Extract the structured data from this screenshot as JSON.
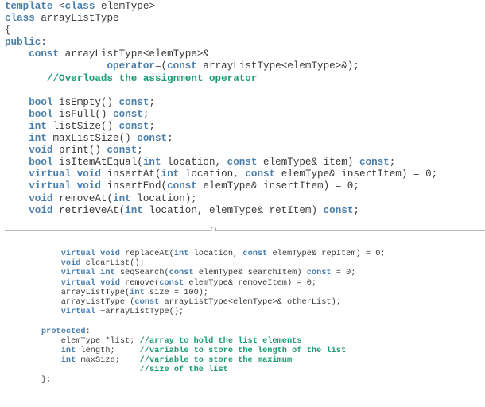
{
  "colors": {
    "keyword": "#4a7fac",
    "comment": "#1e9b76",
    "text": "#3a3a3a",
    "separator": "#b8b8b8"
  },
  "top_section": {
    "lines": [
      [
        {
          "t": "kw",
          "v": "template"
        },
        {
          "t": "tx",
          "v": " <"
        },
        {
          "t": "kw",
          "v": "class"
        },
        {
          "t": "tx",
          "v": " elemType>"
        }
      ],
      [
        {
          "t": "kw",
          "v": "class"
        },
        {
          "t": "tx",
          "v": " arrayListType"
        }
      ],
      [
        {
          "t": "tx",
          "v": "{"
        }
      ],
      [
        {
          "t": "kw",
          "v": "public"
        },
        {
          "t": "tx",
          "v": ":"
        }
      ],
      [
        {
          "t": "tx",
          "v": "    "
        },
        {
          "t": "kw",
          "v": "const"
        },
        {
          "t": "tx",
          "v": " arrayListType<elemType>&"
        }
      ],
      [
        {
          "t": "tx",
          "v": "                 "
        },
        {
          "t": "kw",
          "v": "operator"
        },
        {
          "t": "tx",
          "v": "=("
        },
        {
          "t": "kw",
          "v": "const"
        },
        {
          "t": "tx",
          "v": " arrayListType<elemType>&);"
        }
      ],
      [
        {
          "t": "tx",
          "v": "       "
        },
        {
          "t": "cm",
          "v": "//Overloads the assignment operator"
        }
      ],
      [
        {
          "t": "tx",
          "v": ""
        }
      ],
      [
        {
          "t": "tx",
          "v": "    "
        },
        {
          "t": "kw",
          "v": "bool"
        },
        {
          "t": "tx",
          "v": " isEmpty() "
        },
        {
          "t": "kw",
          "v": "const"
        },
        {
          "t": "tx",
          "v": ";"
        }
      ],
      [
        {
          "t": "tx",
          "v": "    "
        },
        {
          "t": "kw",
          "v": "bool"
        },
        {
          "t": "tx",
          "v": " isFull() "
        },
        {
          "t": "kw",
          "v": "const"
        },
        {
          "t": "tx",
          "v": ";"
        }
      ],
      [
        {
          "t": "tx",
          "v": "    "
        },
        {
          "t": "kw",
          "v": "int"
        },
        {
          "t": "tx",
          "v": " listSize() "
        },
        {
          "t": "kw",
          "v": "const"
        },
        {
          "t": "tx",
          "v": ";"
        }
      ],
      [
        {
          "t": "tx",
          "v": "    "
        },
        {
          "t": "kw",
          "v": "int"
        },
        {
          "t": "tx",
          "v": " maxListSize() "
        },
        {
          "t": "kw",
          "v": "const"
        },
        {
          "t": "tx",
          "v": ";"
        }
      ],
      [
        {
          "t": "tx",
          "v": "    "
        },
        {
          "t": "kw",
          "v": "void"
        },
        {
          "t": "tx",
          "v": " print() "
        },
        {
          "t": "kw",
          "v": "const"
        },
        {
          "t": "tx",
          "v": ";"
        }
      ],
      [
        {
          "t": "tx",
          "v": "    "
        },
        {
          "t": "kw",
          "v": "bool"
        },
        {
          "t": "tx",
          "v": " isItemAtEqual("
        },
        {
          "t": "kw",
          "v": "int"
        },
        {
          "t": "tx",
          "v": " location, "
        },
        {
          "t": "kw",
          "v": "const"
        },
        {
          "t": "tx",
          "v": " elemType& item) "
        },
        {
          "t": "kw",
          "v": "const"
        },
        {
          "t": "tx",
          "v": ";"
        }
      ],
      [
        {
          "t": "tx",
          "v": "    "
        },
        {
          "t": "kw",
          "v": "virtual void"
        },
        {
          "t": "tx",
          "v": " insertAt("
        },
        {
          "t": "kw",
          "v": "int"
        },
        {
          "t": "tx",
          "v": " location, "
        },
        {
          "t": "kw",
          "v": "const"
        },
        {
          "t": "tx",
          "v": " elemType& insertItem) = 0;"
        }
      ],
      [
        {
          "t": "tx",
          "v": "    "
        },
        {
          "t": "kw",
          "v": "virtual void"
        },
        {
          "t": "tx",
          "v": " insertEnd("
        },
        {
          "t": "kw",
          "v": "const"
        },
        {
          "t": "tx",
          "v": " elemType& insertItem) = 0;"
        }
      ],
      [
        {
          "t": "tx",
          "v": "    "
        },
        {
          "t": "kw",
          "v": "void"
        },
        {
          "t": "tx",
          "v": " removeAt("
        },
        {
          "t": "kw",
          "v": "int"
        },
        {
          "t": "tx",
          "v": " location);"
        }
      ],
      [
        {
          "t": "tx",
          "v": "    "
        },
        {
          "t": "kw",
          "v": "void"
        },
        {
          "t": "tx",
          "v": " retrieveAt("
        },
        {
          "t": "kw",
          "v": "int"
        },
        {
          "t": "tx",
          "v": " location, elemType& retItem) "
        },
        {
          "t": "kw",
          "v": "const"
        },
        {
          "t": "tx",
          "v": ";"
        }
      ]
    ]
  },
  "bottom_section": {
    "lines": [
      [
        {
          "t": "tx",
          "v": "    "
        },
        {
          "t": "kw",
          "v": "virtual void"
        },
        {
          "t": "tx",
          "v": " replaceAt("
        },
        {
          "t": "kw",
          "v": "int"
        },
        {
          "t": "tx",
          "v": " location, "
        },
        {
          "t": "kw",
          "v": "const"
        },
        {
          "t": "tx",
          "v": " elemType& repItem) = 0;"
        }
      ],
      [
        {
          "t": "tx",
          "v": "    "
        },
        {
          "t": "kw",
          "v": "void"
        },
        {
          "t": "tx",
          "v": " clearList();"
        }
      ],
      [
        {
          "t": "tx",
          "v": "    "
        },
        {
          "t": "kw",
          "v": "virtual int"
        },
        {
          "t": "tx",
          "v": " seqSearch("
        },
        {
          "t": "kw",
          "v": "const"
        },
        {
          "t": "tx",
          "v": " elemType& searchItem) "
        },
        {
          "t": "kw",
          "v": "const"
        },
        {
          "t": "tx",
          "v": " = 0;"
        }
      ],
      [
        {
          "t": "tx",
          "v": "    "
        },
        {
          "t": "kw",
          "v": "virtual void"
        },
        {
          "t": "tx",
          "v": " remove("
        },
        {
          "t": "kw",
          "v": "const"
        },
        {
          "t": "tx",
          "v": " elemType& removeItem) = 0;"
        }
      ],
      [
        {
          "t": "tx",
          "v": "    arrayListType("
        },
        {
          "t": "kw",
          "v": "int"
        },
        {
          "t": "tx",
          "v": " size = 100);"
        }
      ],
      [
        {
          "t": "tx",
          "v": "    arrayListType ("
        },
        {
          "t": "kw",
          "v": "const"
        },
        {
          "t": "tx",
          "v": " arrayListType<elemType>& otherList);"
        }
      ],
      [
        {
          "t": "tx",
          "v": "    "
        },
        {
          "t": "kw",
          "v": "virtual"
        },
        {
          "t": "tx",
          "v": " ~arrayListType();"
        }
      ],
      [
        {
          "t": "tx",
          "v": ""
        }
      ],
      [
        {
          "t": "kw",
          "v": "protected"
        },
        {
          "t": "tx",
          "v": ":"
        }
      ],
      [
        {
          "t": "tx",
          "v": "    elemType *list; "
        },
        {
          "t": "cm",
          "v": "//array to hold the list elements"
        }
      ],
      [
        {
          "t": "tx",
          "v": "    "
        },
        {
          "t": "kw",
          "v": "int"
        },
        {
          "t": "tx",
          "v": " length;     "
        },
        {
          "t": "cm",
          "v": "//variable to store the length of the list"
        }
      ],
      [
        {
          "t": "tx",
          "v": "    "
        },
        {
          "t": "kw",
          "v": "int"
        },
        {
          "t": "tx",
          "v": " maxSize;    "
        },
        {
          "t": "cm",
          "v": "//variable to store the maximum"
        }
      ],
      [
        {
          "t": "tx",
          "v": "                    "
        },
        {
          "t": "cm",
          "v": "//size of the list"
        }
      ],
      [
        {
          "t": "tx",
          "v": "};"
        }
      ]
    ]
  }
}
